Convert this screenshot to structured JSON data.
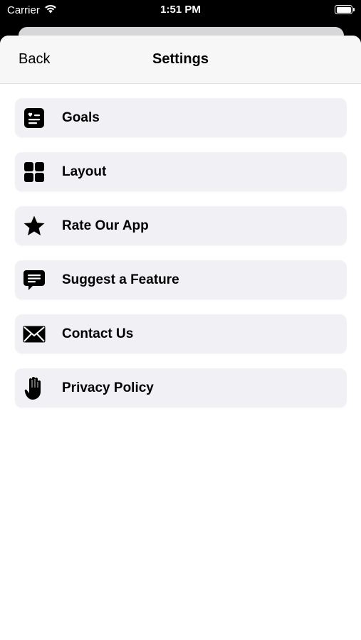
{
  "status": {
    "carrier": "Carrier",
    "time": "1:51 PM"
  },
  "nav": {
    "back_label": "Back",
    "title": "Settings"
  },
  "items": [
    {
      "label": "Goals",
      "icon": "goals-card-icon"
    },
    {
      "label": "Layout",
      "icon": "grid-icon"
    },
    {
      "label": "Rate Our App",
      "icon": "star-icon"
    },
    {
      "label": "Suggest a Feature",
      "icon": "chat-bubble-icon"
    },
    {
      "label": "Contact Us",
      "icon": "envelope-icon"
    },
    {
      "label": "Privacy Policy",
      "icon": "hand-icon"
    }
  ]
}
